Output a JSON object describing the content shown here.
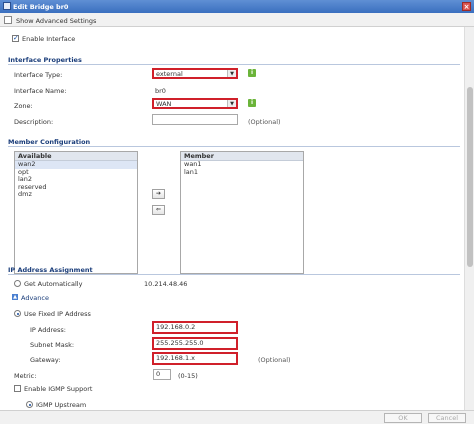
{
  "window": {
    "title": "Edit Bridge br0",
    "close": "×"
  },
  "toolbar": {
    "show_advanced": "Show Advanced Settings"
  },
  "general": {
    "enable_interface": "Enable Interface"
  },
  "props": {
    "section": "Interface Properties",
    "type_label": "Interface Type:",
    "type_value": "external",
    "name_label": "Interface Name:",
    "name_value": "br0",
    "zone_label": "Zone:",
    "zone_value": "WAN",
    "desc_label": "Description:",
    "desc_value": "",
    "desc_hint": "(Optional)",
    "info": "i"
  },
  "members": {
    "section": "Member Configuration",
    "available_header": "Available",
    "available": [
      "wan2",
      "opt",
      "lan2",
      "reserved",
      "dmz"
    ],
    "member_header": "Member",
    "member": [
      "wan1",
      "lan1"
    ],
    "add": "➔",
    "remove": "⇐"
  },
  "ip": {
    "section": "IP Address Assignment",
    "get_auto": "Get Automatically",
    "auto_value": "10.214.48.46",
    "advance": "Advance",
    "advance_toggle": "▲",
    "use_fixed": "Use Fixed IP Address",
    "ip_label": "IP Address:",
    "ip_value": "192.168.0.2",
    "mask_label": "Subnet Mask:",
    "mask_value": "255.255.255.0",
    "gw_label": "Gateway:",
    "gw_value": "192.168.1.x",
    "gw_hint": "(Optional)",
    "metric_label": "Metric:",
    "metric_value": "0",
    "metric_hint": "(0-15)",
    "igmp": "Enable IGMP Support",
    "igmp_upstream": "IGMP Upstream"
  },
  "footer": {
    "ok": "OK",
    "cancel": "Cancel"
  },
  "colors": {
    "title_bar": "#3a6fbf",
    "highlight_border": "#d0202a",
    "info_icon": "#6bb43a"
  }
}
